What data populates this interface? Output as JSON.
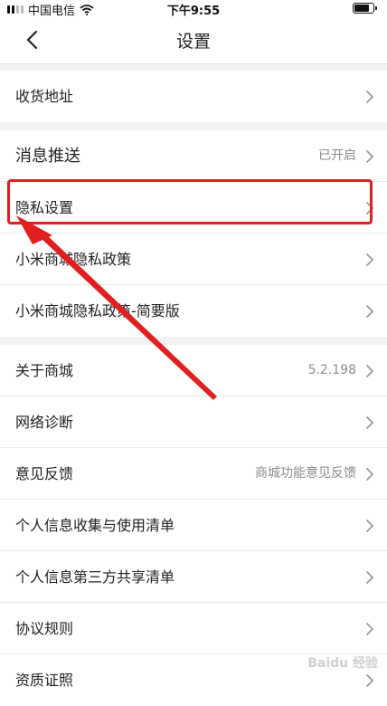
{
  "status_bar": {
    "carrier": "中国电信",
    "time": "下午9:55"
  },
  "header": {
    "title": "设置"
  },
  "groups": [
    {
      "items": [
        {
          "label": "收货地址",
          "value": ""
        }
      ]
    },
    {
      "items": [
        {
          "label": "消息推送",
          "value": "已开启"
        },
        {
          "label": "隐私设置",
          "value": ""
        },
        {
          "label": "小米商城隐私政策",
          "value": ""
        },
        {
          "label": "小米商城隐私政策-简要版",
          "value": ""
        }
      ]
    },
    {
      "items": [
        {
          "label": "关于商城",
          "value": "5.2.198"
        },
        {
          "label": "网络诊断",
          "value": ""
        },
        {
          "label": "意见反馈",
          "value": "商城功能意见反馈"
        },
        {
          "label": "个人信息收集与使用清单",
          "value": ""
        },
        {
          "label": "个人信息第三方共享清单",
          "value": ""
        },
        {
          "label": "协议规则",
          "value": ""
        },
        {
          "label": "资质证照",
          "value": ""
        }
      ]
    }
  ],
  "annotation": {
    "highlight_color": "#e21f1f"
  },
  "watermark": {
    "text": "Baidu 经验"
  }
}
